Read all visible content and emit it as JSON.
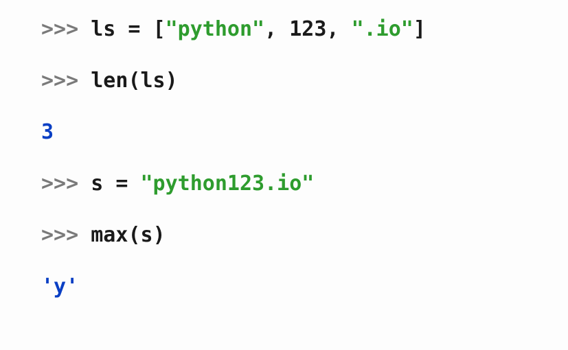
{
  "lines": {
    "l1": {
      "prompt": ">>> ",
      "var": "ls",
      "eq": " = ",
      "open": "[",
      "s1": "\"python\"",
      "c1": ", ",
      "n1": "123",
      "c2": ", ",
      "s2": "\".io\"",
      "close": "]"
    },
    "l2": {
      "prompt": ">>> ",
      "func": "len",
      "open": "(",
      "arg": "ls",
      "close": ")"
    },
    "l3": {
      "out": "3"
    },
    "l4": {
      "prompt": ">>> ",
      "var": "s",
      "eq": " = ",
      "str": "\"python123.io\""
    },
    "l5": {
      "prompt": ">>> ",
      "func": "max",
      "open": "(",
      "arg": "s",
      "close": ")"
    },
    "l6": {
      "out": "'y'"
    }
  }
}
